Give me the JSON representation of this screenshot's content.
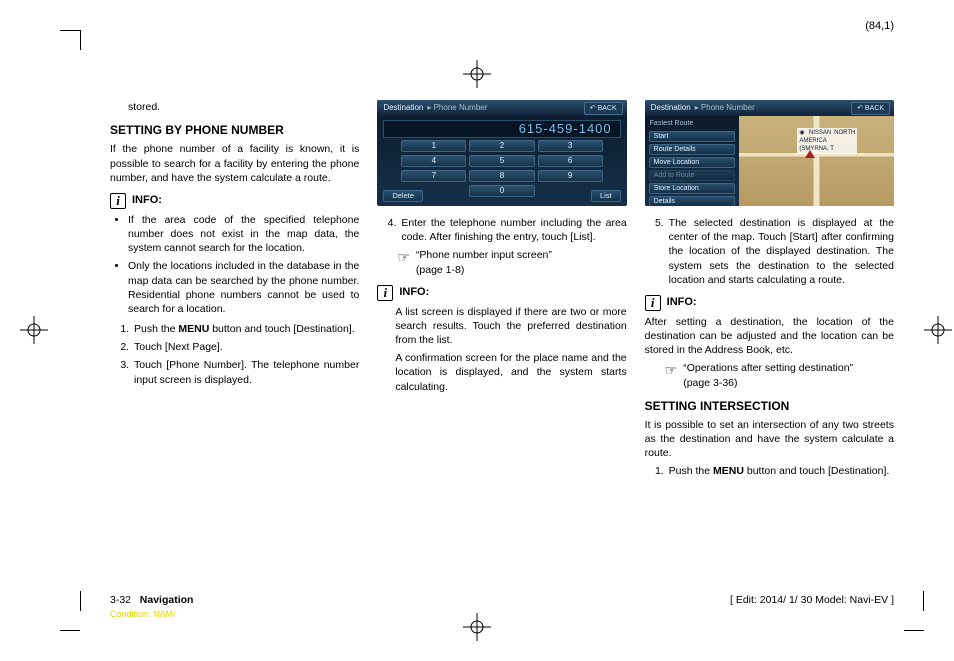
{
  "page_coord": "(84,1)",
  "col1": {
    "stored": "stored.",
    "h_phone": "SETTING BY PHONE NUMBER",
    "p_phone_intro": "If the phone number of a facility is known, it is possible to search for a facility by entering the phone number, and have the system calculate a route.",
    "info_label": "INFO:",
    "bullet1": "If the area code of the specified telephone number does not exist in the map data, the system cannot search for the location.",
    "bullet2": "Only the locations included in the database in the map data can be searched by the phone number. Residential phone numbers cannot be used to search for a location.",
    "step1_a": "Push the ",
    "step1_menu": "MENU",
    "step1_b": " button and touch [Destination].",
    "step2": "Touch [Next Page].",
    "step3": "Touch [Phone Number]. The telephone number input screen is displayed."
  },
  "col2": {
    "ss1": {
      "title_a": "Destination",
      "title_b": "▸ Phone Number",
      "back": "↶ BACK",
      "display": "615-459-1400",
      "k1": "1",
      "k2": "2",
      "k3": "3",
      "k4": "4",
      "k5": "5",
      "k6": "6",
      "k7": "7",
      "k8": "8",
      "k9": "9",
      "k0": "0",
      "delete": "Delete",
      "list": "List"
    },
    "step4": "Enter the telephone number including the area code. After finishing the entry, touch [List].",
    "ref1_a": "“Phone number input screen”",
    "ref1_b": "(page 1-8)",
    "info_label": "INFO:",
    "p_info_a": "A list screen is displayed if there are two or more search results. Touch the preferred destination from the list.",
    "p_info_b": "A confirmation screen for the place name and the location is displayed, and the system starts calculating."
  },
  "col3": {
    "ss2": {
      "title_a": "Destination",
      "title_b": "▸ Phone Number",
      "back": "↶ BACK",
      "side_title": "Fastest Route",
      "i1": "Start",
      "i2": "Route Details",
      "i3": "Move Location",
      "i4": "Add to Route",
      "i5": "Store Location",
      "i6": "Details",
      "pin": "◉ NISSAN NORTH AMERICA (SMYRNA, T"
    },
    "step5": "The selected destination is displayed at the center of the map. Touch [Start] after confirming the location of the displayed destination. The system sets the destination to the selected location and starts calculating a route.",
    "info_label": "INFO:",
    "p_info": "After setting a destination, the location of the destination can be adjusted and the location can be stored in the Address Book, etc.",
    "ref_a": "“Operations after setting destination”",
    "ref_b": "(page 3-36)",
    "h_intersection": "SETTING INTERSECTION",
    "p_intersection": "It is possible to set an intersection of any two streets as the destination and have the system calculate a route.",
    "step1_a": "Push the ",
    "step1_menu": "MENU",
    "step1_b": " button and touch [Destination]."
  },
  "footer": {
    "page": "3-32",
    "section": "Navigation",
    "edit": "[ Edit: 2014/ 1/ 30   Model: Navi-EV ]"
  },
  "condition": "Condition: NAM/"
}
